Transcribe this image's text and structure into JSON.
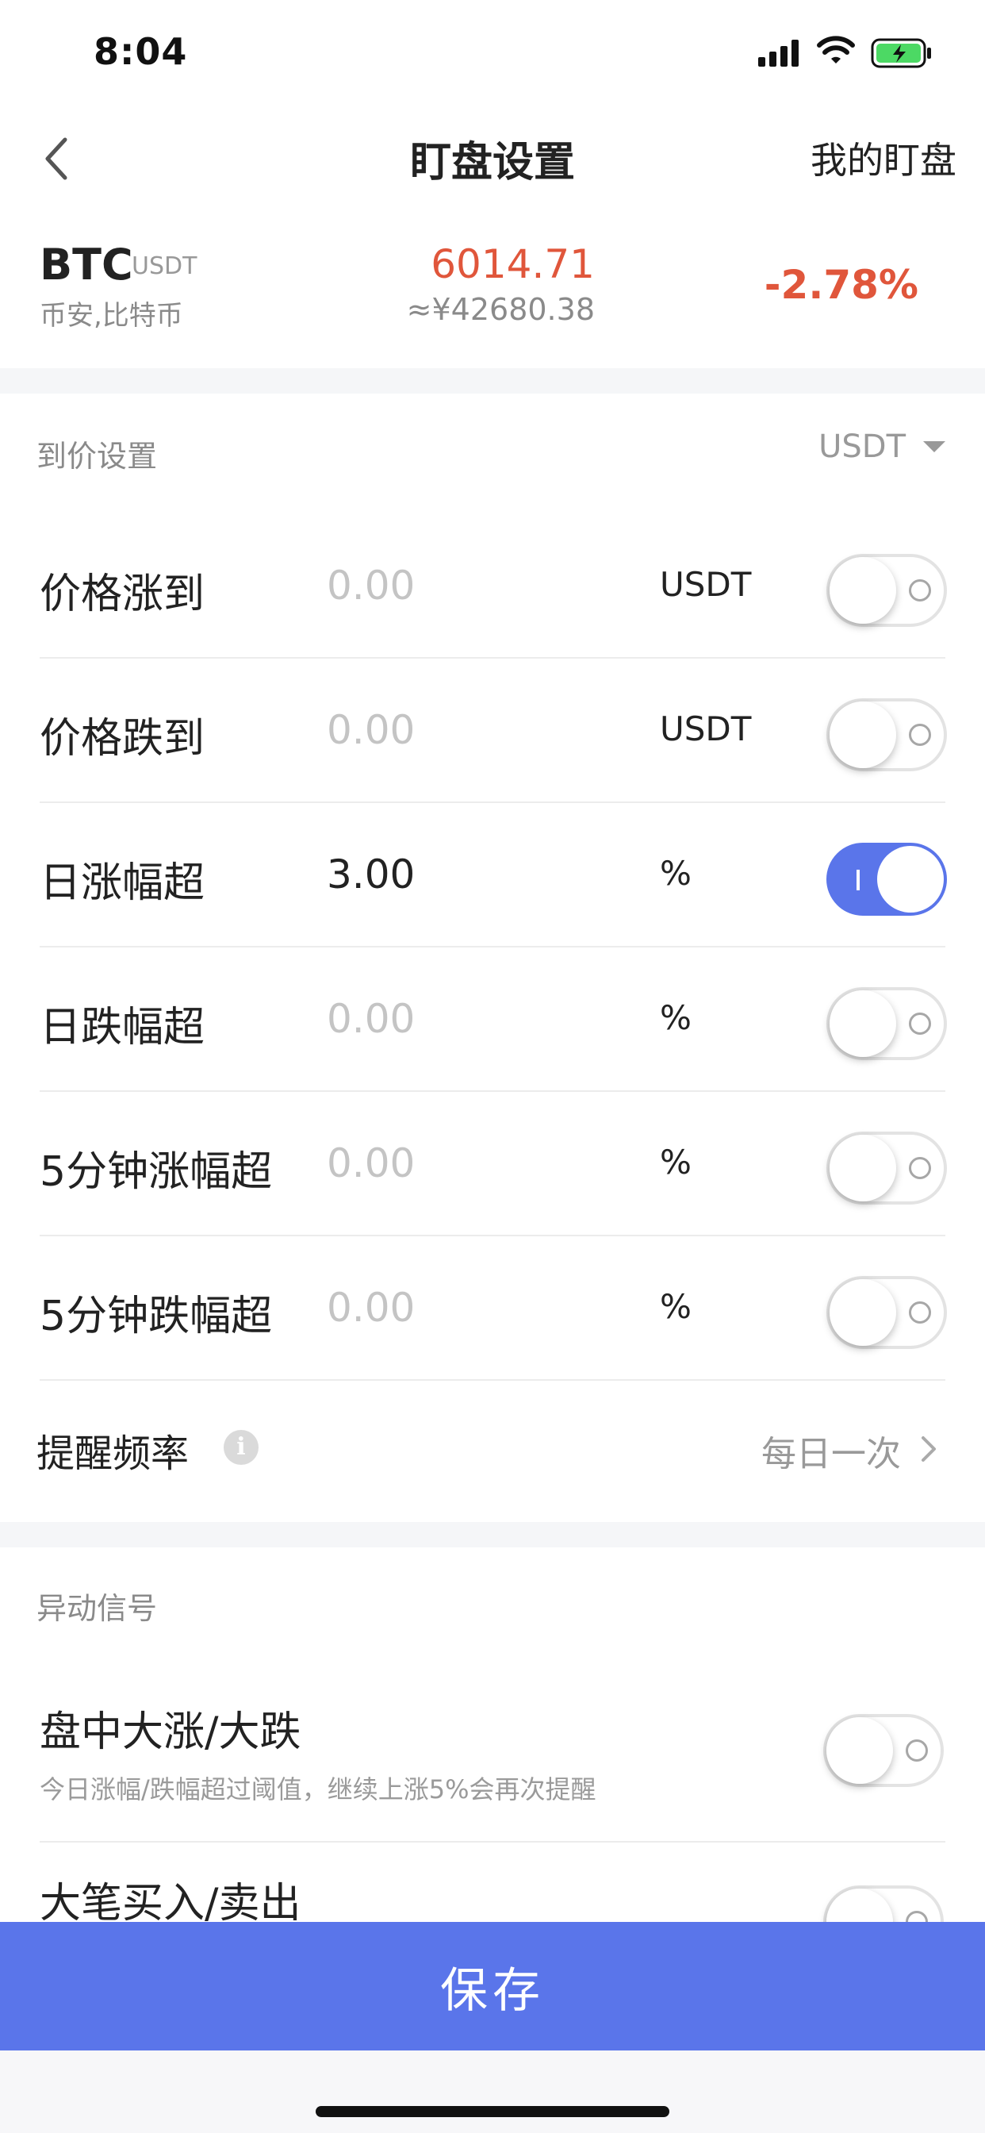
{
  "status_bar": {
    "time": "8:04"
  },
  "nav": {
    "title": "盯盘设置",
    "right_label": "我的盯盘"
  },
  "coin": {
    "symbol": "BTC",
    "quote": "USDT",
    "name": "币安,比特币",
    "price": "6014.71",
    "price_cny": "≈¥42680.38",
    "change": "-2.78%"
  },
  "price_section": {
    "title": "到价设置",
    "currency": "USDT",
    "rows": [
      {
        "label": "价格涨到",
        "value": "",
        "placeholder": "0.00",
        "unit": "USDT",
        "enabled": false
      },
      {
        "label": "价格跌到",
        "value": "",
        "placeholder": "0.00",
        "unit": "USDT",
        "enabled": false
      },
      {
        "label": "日涨幅超",
        "value": "3.00",
        "placeholder": "0.00",
        "unit": "%",
        "enabled": true
      },
      {
        "label": "日跌幅超",
        "value": "",
        "placeholder": "0.00",
        "unit": "%",
        "enabled": false
      },
      {
        "label": "5分钟涨幅超",
        "value": "",
        "placeholder": "0.00",
        "unit": "%",
        "enabled": false
      },
      {
        "label": "5分钟跌幅超",
        "value": "",
        "placeholder": "0.00",
        "unit": "%",
        "enabled": false
      }
    ],
    "frequency": {
      "label": "提醒频率",
      "value": "每日一次"
    }
  },
  "signal_section": {
    "title": "异动信号",
    "rows": [
      {
        "title": "盘中大涨/大跌",
        "desc": "今日涨幅/跌幅超过阈值，继续上涨5%会再次提醒",
        "enabled": false
      },
      {
        "title": "大笔买入/卖出",
        "desc": "",
        "enabled": false
      }
    ]
  },
  "save_label": "保存",
  "colors": {
    "accent": "#5a75ea",
    "down_red": "#e0563b"
  }
}
